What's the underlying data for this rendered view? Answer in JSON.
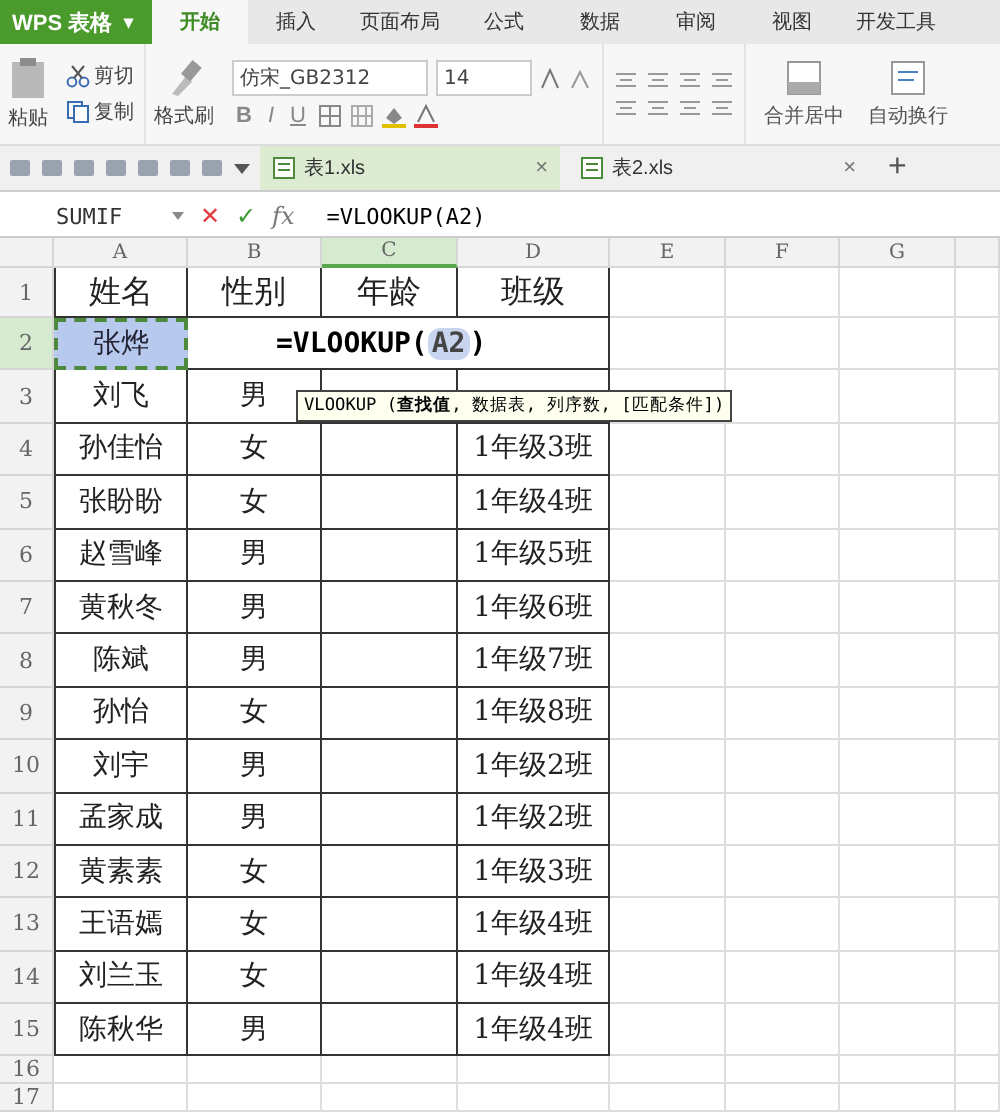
{
  "app_menu": {
    "label": "WPS 表格",
    "caret": "▾"
  },
  "ribbon_tabs": [
    {
      "label": "开始",
      "selected": true
    },
    {
      "label": "插入",
      "selected": false
    },
    {
      "label": "页面布局",
      "selected": false
    },
    {
      "label": "公式",
      "selected": false
    },
    {
      "label": "数据",
      "selected": false
    },
    {
      "label": "审阅",
      "selected": false
    },
    {
      "label": "视图",
      "selected": false
    },
    {
      "label": "开发工具",
      "selected": false
    }
  ],
  "ribbon": {
    "paste": "粘贴",
    "cut": "剪切",
    "copy": "复制",
    "format_painter": "格式刷",
    "font_name": "仿宋_GB2312",
    "font_size": "14",
    "style_buttons": [
      "B",
      "I",
      "U"
    ],
    "merge": "合并居中",
    "wrap": "自动换行"
  },
  "doc_tabs": [
    {
      "label": "表1.xls",
      "selected": true,
      "close": "×"
    },
    {
      "label": "表2.xls",
      "selected": false,
      "close": "×"
    }
  ],
  "new_tab": "+",
  "formula_bar": {
    "name_box": "SUMIF",
    "cancel": "✕",
    "confirm": "✓",
    "fx": "fx",
    "formula": "=VLOOKUP(A2)"
  },
  "columns": [
    {
      "label": "A",
      "selected": false
    },
    {
      "label": "B",
      "selected": false
    },
    {
      "label": "C",
      "selected": true
    },
    {
      "label": "D",
      "selected": false
    },
    {
      "label": "E",
      "selected": false
    },
    {
      "label": "F",
      "selected": false
    },
    {
      "label": "G",
      "selected": false
    }
  ],
  "rows": [
    {
      "number": "1",
      "selected": false,
      "cells": [
        "姓名",
        "性别",
        "年龄",
        "班级"
      ]
    },
    {
      "number": "2",
      "selected": true,
      "cells": [
        "张烨"
      ]
    },
    {
      "number": "3",
      "selected": false,
      "cells": [
        "刘飞",
        "男"
      ]
    },
    {
      "number": "4",
      "selected": false,
      "cells": [
        "孙佳怡",
        "女",
        "",
        "1年级3班"
      ]
    },
    {
      "number": "5",
      "selected": false,
      "cells": [
        "张盼盼",
        "女",
        "",
        "1年级4班"
      ]
    },
    {
      "number": "6",
      "selected": false,
      "cells": [
        "赵雪峰",
        "男",
        "",
        "1年级5班"
      ]
    },
    {
      "number": "7",
      "selected": false,
      "cells": [
        "黄秋冬",
        "男",
        "",
        "1年级6班"
      ]
    },
    {
      "number": "8",
      "selected": false,
      "cells": [
        "陈斌",
        "男",
        "",
        "1年级7班"
      ]
    },
    {
      "number": "9",
      "selected": false,
      "cells": [
        "孙怡",
        "女",
        "",
        "1年级8班"
      ]
    },
    {
      "number": "10",
      "selected": false,
      "cells": [
        "刘宇",
        "男",
        "",
        "1年级2班"
      ]
    },
    {
      "number": "11",
      "selected": false,
      "cells": [
        "孟家成",
        "男",
        "",
        "1年级2班"
      ]
    },
    {
      "number": "12",
      "selected": false,
      "cells": [
        "黄素素",
        "女",
        "",
        "1年级3班"
      ]
    },
    {
      "number": "13",
      "selected": false,
      "cells": [
        "王语嫣",
        "女",
        "",
        "1年级4班"
      ]
    },
    {
      "number": "14",
      "selected": false,
      "cells": [
        "刘兰玉",
        "女",
        "",
        "1年级4班"
      ]
    },
    {
      "number": "15",
      "selected": false,
      "cells": [
        "陈秋华",
        "男",
        "",
        "1年级4班"
      ]
    },
    {
      "number": "16",
      "selected": false,
      "cells": []
    },
    {
      "number": "17",
      "selected": false,
      "cells": []
    }
  ],
  "cell_editor": {
    "prefix": "=VLOOKUP(",
    "reference": "A2",
    "suffix": ")"
  },
  "tooltip": "VLOOKUP (**查找值**, 数据表, 列序数, [匹配条件])"
}
